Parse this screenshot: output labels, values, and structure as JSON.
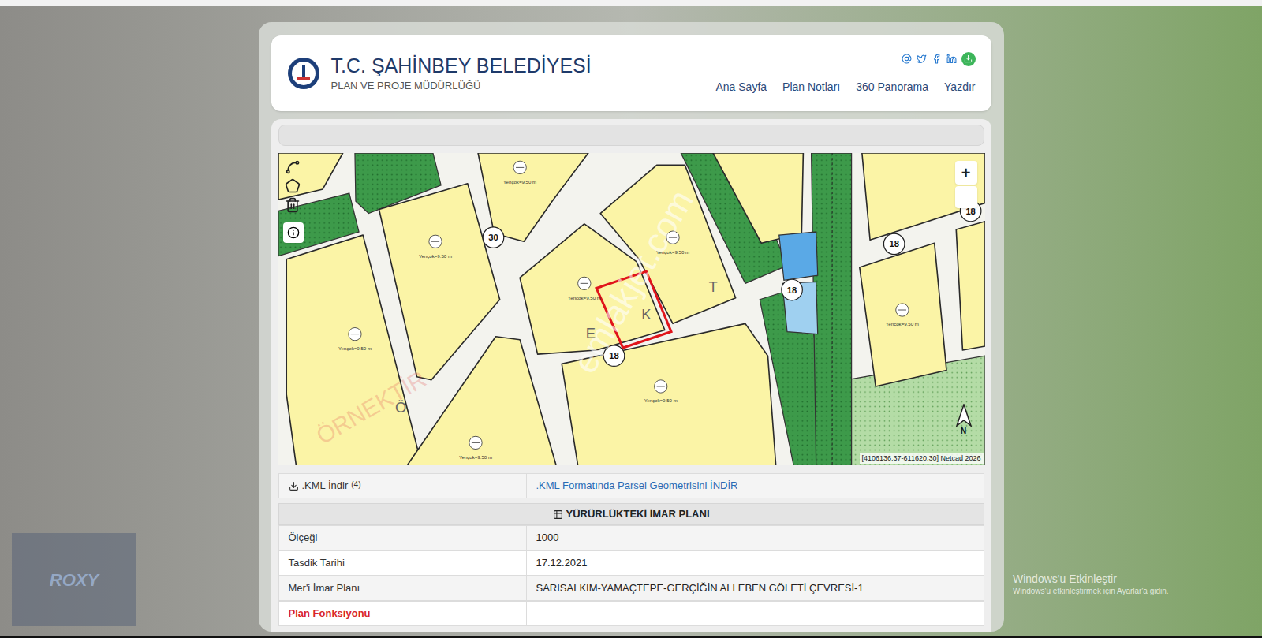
{
  "header": {
    "title": "T.C. ŞAHİNBEY BELEDİYESİ",
    "subtitle": "PLAN VE PROJE MÜDÜRLÜĞÜ"
  },
  "nav": [
    "Ana Sayfa",
    "Plan Notları",
    "360 Panorama",
    "Yazdır"
  ],
  "map": {
    "zoom_in": "+",
    "north": "N",
    "coordinates": "[4106136.37-611620.30] Netcad 2026",
    "road_widths": [
      "30",
      "18",
      "18",
      "18",
      "18"
    ],
    "street_letters": [
      "E",
      "K",
      "T",
      "Ö"
    ],
    "block_labels": [
      "Yençok=9.50 m",
      "Yençok=9.50 m",
      "Yençok=9.50 m",
      "Yençok=9.50 m",
      "Yençok=9.50 m",
      "Yençok=9.50 m",
      "Yençok=9.50 m",
      "Yençok=9.50 m"
    ]
  },
  "watermarks": [
    "emlakjet.com",
    "ÖRNEKTİR"
  ],
  "table": {
    "rows": [
      {
        "kind": "download",
        "label": ".KML İndir",
        "note": "(4)",
        "value": ".KML Formatında Parsel Geometrisini İNDİR"
      },
      {
        "kind": "section",
        "label": "YÜRÜRLÜKTEKİ İMAR PLANI"
      },
      {
        "kind": "field",
        "label": "Ölçeği",
        "value": "1000"
      },
      {
        "kind": "field",
        "label": "Tasdik Tarihi",
        "value": "17.12.2021"
      },
      {
        "kind": "field",
        "label": "Mer'i İmar Planı",
        "value": "SARISALKIM-YAMAÇTEPE-GERÇİĞİN ALLEBEN GÖLETİ ÇEVRESİ-1"
      },
      {
        "kind": "cut",
        "label": "Plan Fonksiyonu"
      }
    ]
  },
  "overlay_logo": "ROXY",
  "os_notice": {
    "title": "Windows'u Etkinleştir",
    "message": "Windows'u etkinleştirmek için Ayarlar'a gidin."
  }
}
